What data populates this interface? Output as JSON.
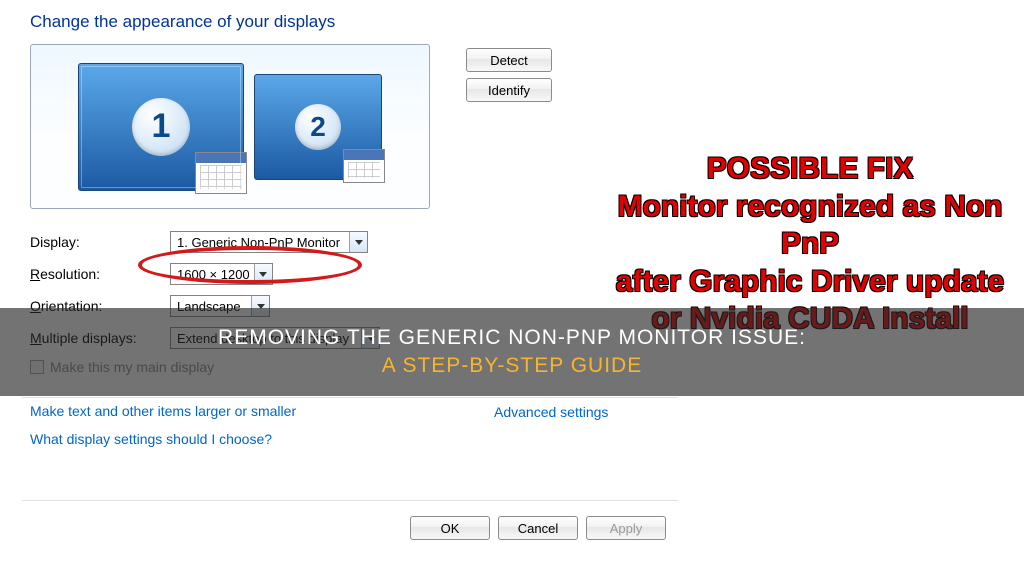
{
  "header": {
    "title": "Change the appearance of your displays"
  },
  "preview": {
    "monitor1_num": "1",
    "monitor2_num": "2",
    "detect_label": "Detect",
    "identify_label": "Identify"
  },
  "fields": {
    "display_label": "Display:",
    "display_value": "1. Generic Non-PnP Monitor",
    "resolution_label": "Resolution:",
    "resolution_value": "1600 × 1200",
    "orientation_label": "Orientation:",
    "orientation_value": "Landscape",
    "multiple_label": "Multiple displays:",
    "multiple_value": "Extend desktop to this display"
  },
  "checkbox": {
    "label": "Make this my main display"
  },
  "links": {
    "advanced": "Advanced settings",
    "larger": "Make text and other items larger or smaller",
    "help": "What display settings should I choose?"
  },
  "buttons": {
    "ok": "OK",
    "cancel": "Cancel",
    "apply": "Apply"
  },
  "annotation": {
    "line1": "POSSIBLE FIX",
    "line2": "Monitor recognized as Non PnP",
    "line3": "after Graphic Driver update",
    "line4": "or Nvidia CUDA Install"
  },
  "overlay": {
    "line1": "REMOVING THE GENERIC NON-PNP MONITOR ISSUE:",
    "line2": "A STEP-BY-STEP GUIDE"
  }
}
